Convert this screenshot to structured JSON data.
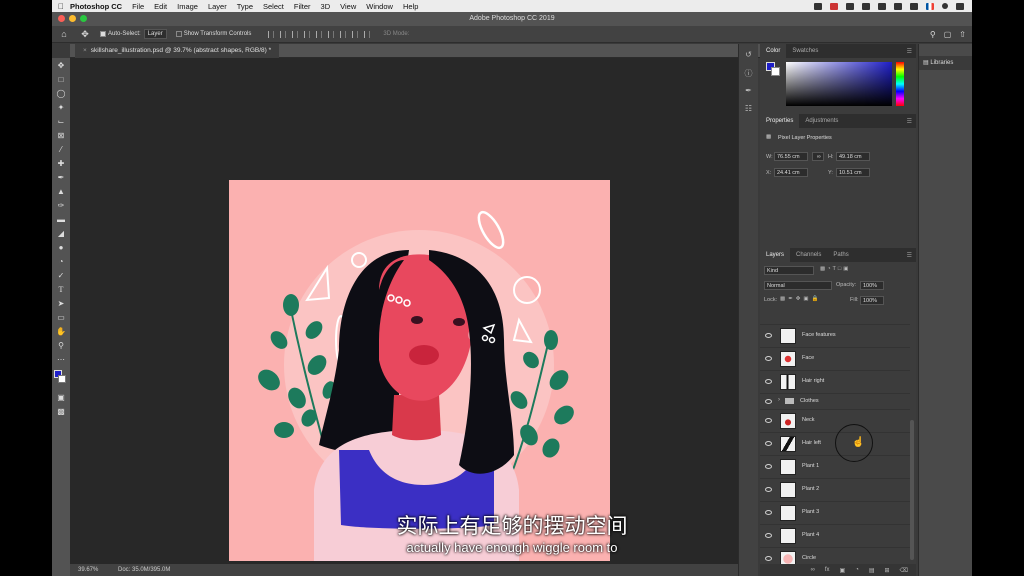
{
  "menubar": {
    "app": "Photoshop CC",
    "items": [
      "File",
      "Edit",
      "Image",
      "Layer",
      "Type",
      "Select",
      "Filter",
      "3D",
      "View",
      "Window",
      "Help"
    ]
  },
  "window": {
    "title": "Adobe Photoshop CC 2019"
  },
  "options": {
    "auto_select": "Auto-Select:",
    "layer_select": "Layer",
    "show_transform": "Show Transform Controls",
    "mode_3d": "3D Mode:"
  },
  "document": {
    "tab": "skillshare_illustration.psd @ 39.7% (abstract shapes, RGB/8) *",
    "zoom": "39.67%",
    "doc_size": "Doc: 35.0M/395.0M"
  },
  "color_panel": {
    "tabs": [
      "Color",
      "Swatches"
    ]
  },
  "properties": {
    "tabs": [
      "Properties",
      "Adjustments"
    ],
    "title": "Pixel Layer Properties",
    "w_label": "W:",
    "w": "76.55 cm",
    "h_label": "H:",
    "h": "49.18 cm",
    "x_label": "X:",
    "x": "24.41 cm",
    "y_label": "Y:",
    "y": "10.51 cm"
  },
  "layers_panel": {
    "tabs": [
      "Layers",
      "Channels",
      "Paths"
    ],
    "kind": "Kind",
    "blend": "Normal",
    "opacity_label": "Opacity:",
    "opacity": "100%",
    "lock_label": "Lock:",
    "fill_label": "Fill:",
    "fill": "100%",
    "layers": [
      {
        "name": "Face features"
      },
      {
        "name": "Face"
      },
      {
        "name": "Hair right"
      },
      {
        "name": "Clothes"
      },
      {
        "name": "Neck"
      },
      {
        "name": "Hair left"
      },
      {
        "name": "Plant 1"
      },
      {
        "name": "Plant 2"
      },
      {
        "name": "Plant 3"
      },
      {
        "name": "Plant 4"
      },
      {
        "name": "Circle"
      }
    ]
  },
  "libraries": {
    "title": "Libraries"
  },
  "subtitles": {
    "chinese": "实际上有足够的摆动空间",
    "english": "actually have enough wiggle room to"
  }
}
